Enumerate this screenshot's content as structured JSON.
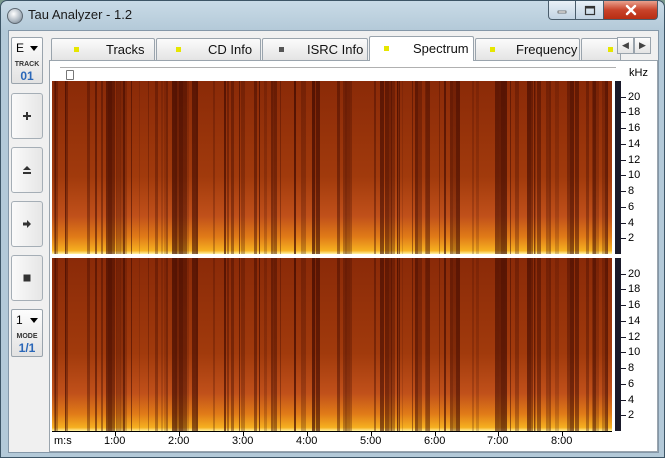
{
  "window": {
    "title": "Tau Analyzer - 1.2"
  },
  "sidebar": {
    "drive": {
      "value": "E"
    },
    "track": {
      "label": "TRACK",
      "value": "01"
    },
    "mode_select": {
      "value": "1"
    },
    "mode": {
      "label": "MODE",
      "value": "1/1"
    }
  },
  "tabs": [
    {
      "label": "Tracks",
      "dot": "#e6e600",
      "active": false
    },
    {
      "label": "CD Info",
      "dot": "#e6e600",
      "active": false
    },
    {
      "label": "ISRC Info",
      "dot": "#555555",
      "active": false
    },
    {
      "label": "Spectrum",
      "dot": "#e6e600",
      "active": true
    },
    {
      "label": "Frequency",
      "dot": "#e6e600",
      "active": false
    }
  ],
  "spectrum": {
    "unit": "kHz",
    "freq_ticks": [
      "20",
      "18",
      "16",
      "14",
      "12",
      "10",
      "8",
      "6",
      "4",
      "2"
    ],
    "time_label": "m:s",
    "time_ticks": [
      "1:00",
      "2:00",
      "3:00",
      "4:00",
      "5:00",
      "6:00",
      "7:00",
      "8:00"
    ],
    "colors": {
      "low": "#8a2a08",
      "mid": "#c0501a",
      "high": "#f6b020"
    }
  }
}
